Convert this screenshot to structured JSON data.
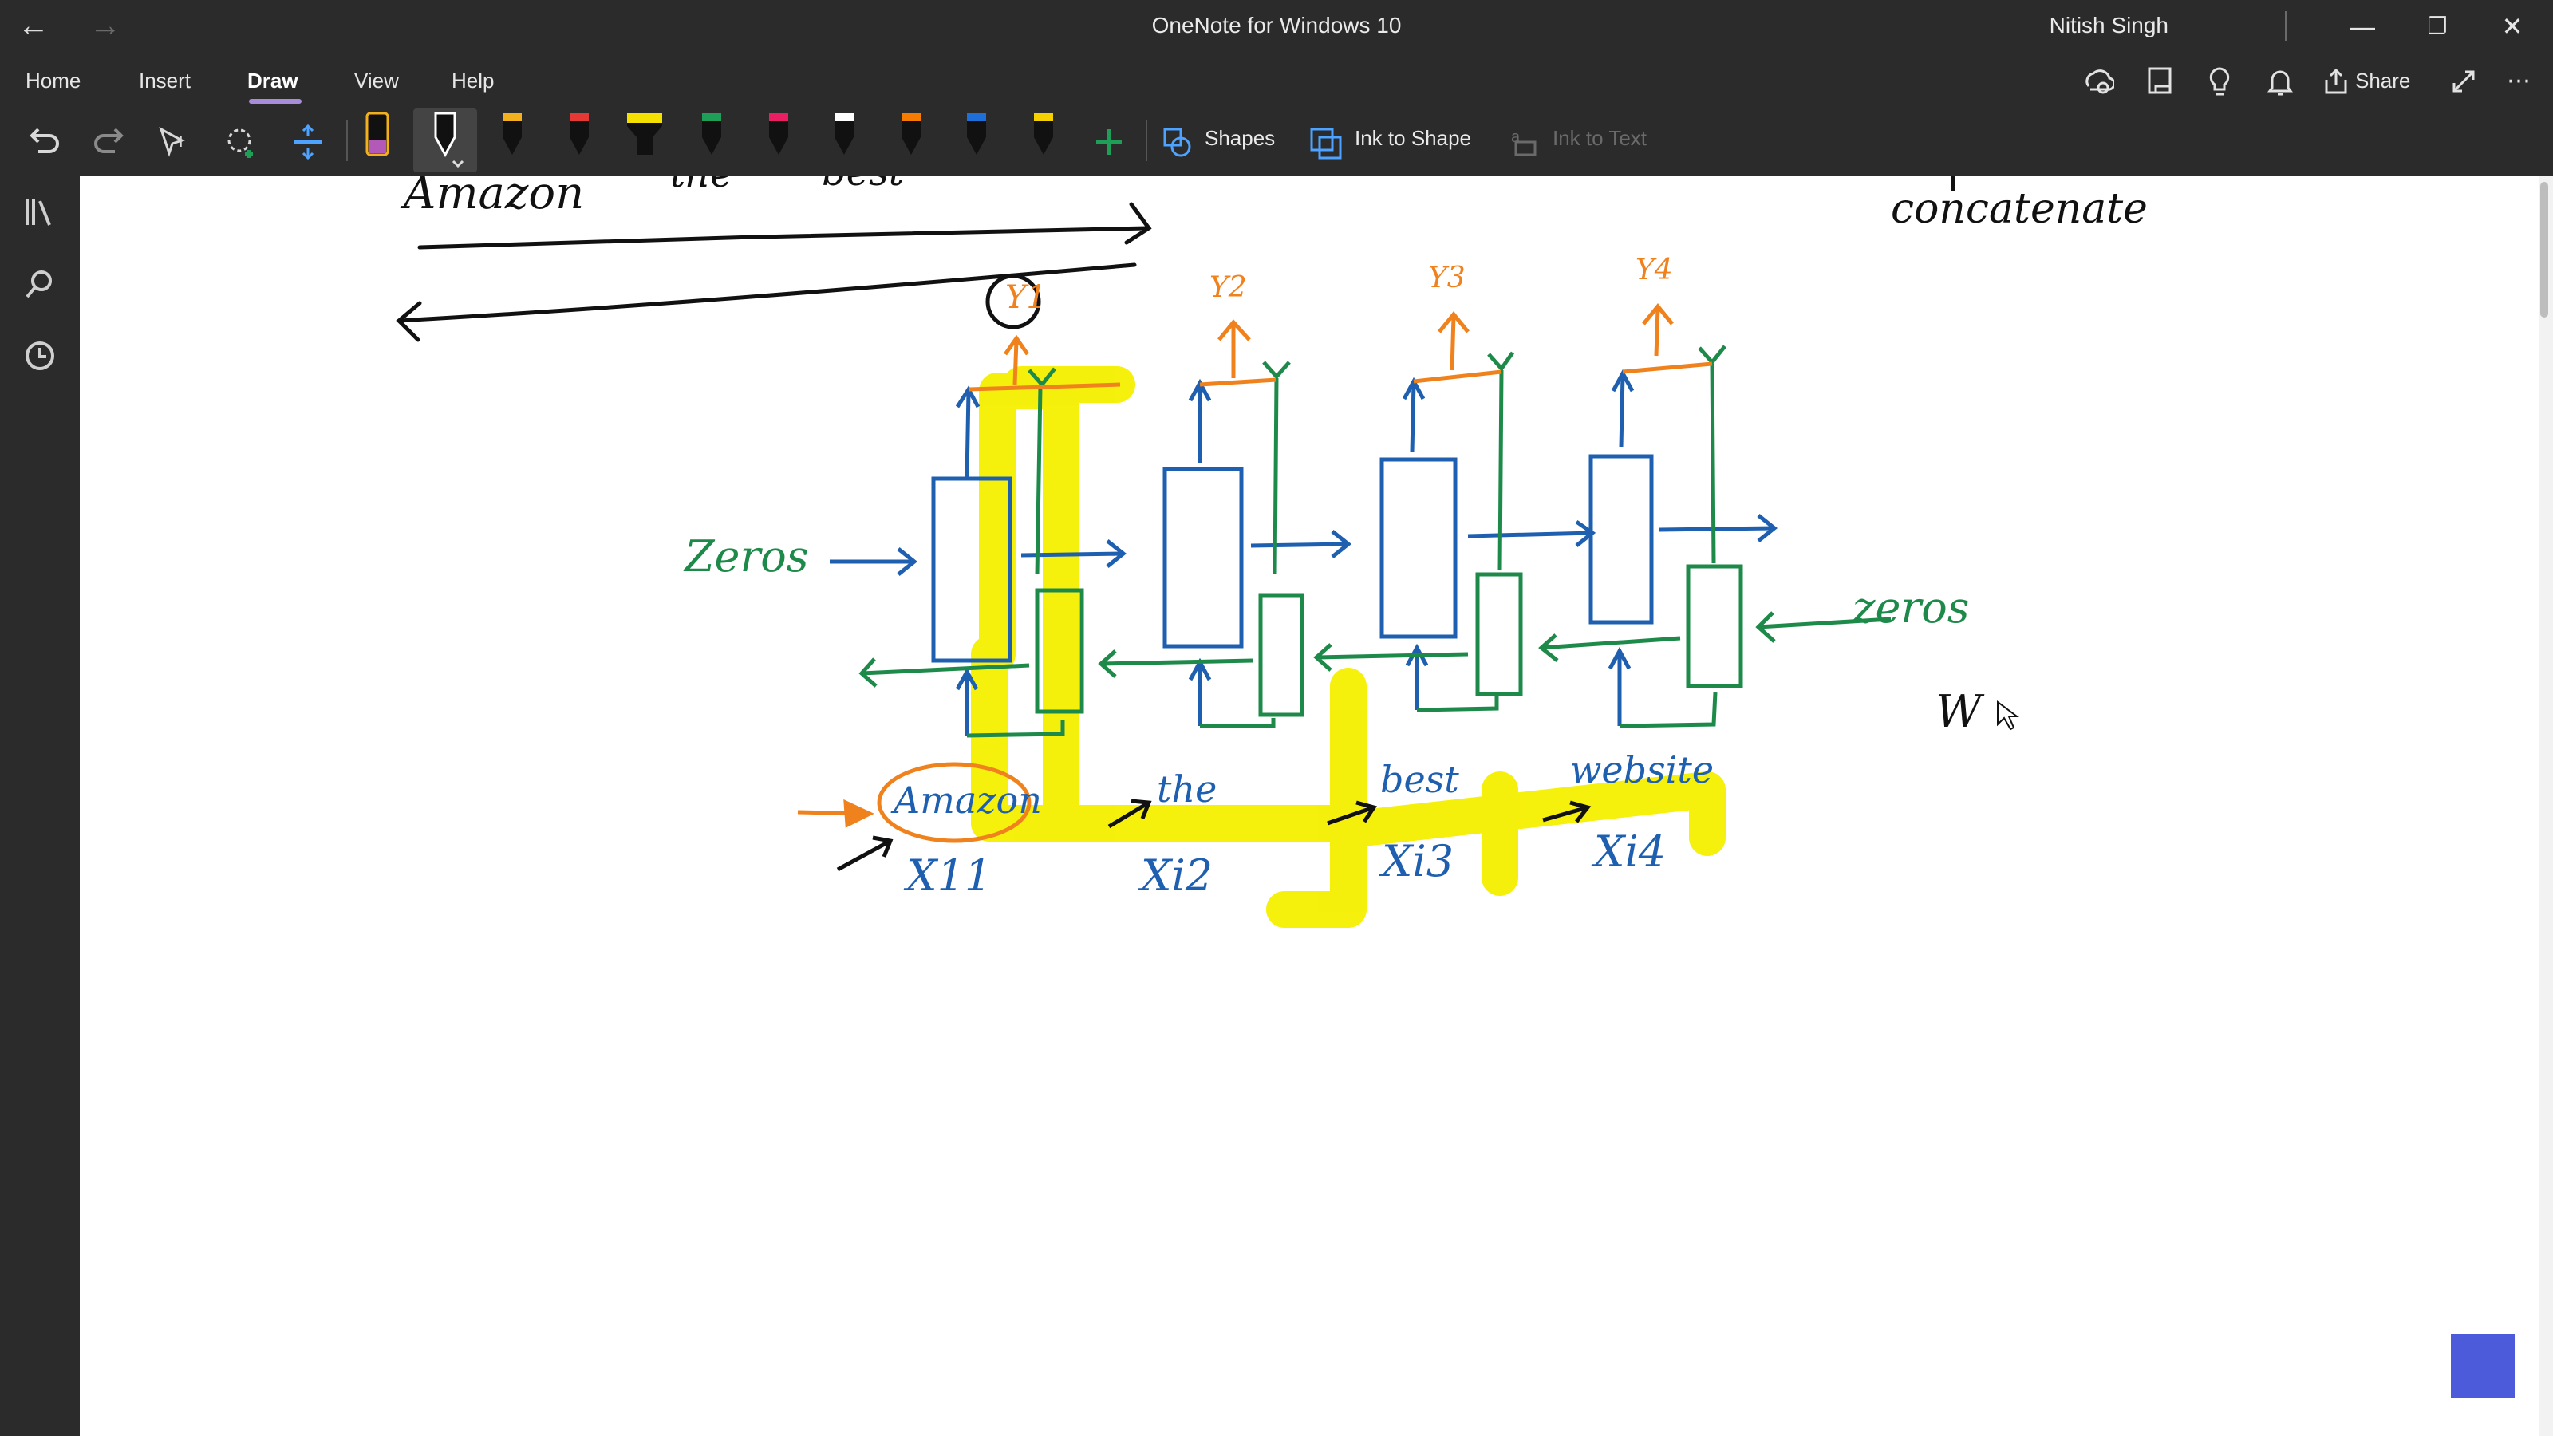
{
  "window": {
    "title": "OneNote for Windows 10",
    "user": "Nitish Singh",
    "back_icon": "back-arrow-icon",
    "forward_icon": "forward-arrow-icon",
    "minimize_label": "—",
    "restore_label": "❐",
    "close_label": "✕"
  },
  "menu": {
    "home": "Home",
    "insert": "Insert",
    "draw": "Draw",
    "view": "View",
    "help": "Help",
    "share": "Share"
  },
  "toolbar": {
    "shapes": "Shapes",
    "ink_to_shape": "Ink to Shape",
    "ink_to_text": "Ink to Text",
    "pen_colors": [
      "#111111",
      "#111111",
      "#f2b01e",
      "#e53935",
      "#f4e000",
      "#1e9e57",
      "#e91e63",
      "#ffffff",
      "#f57c00",
      "#1e6fd9",
      "#f4d000"
    ]
  },
  "ink": {
    "amazon_top": "Amazon",
    "the_top": "the",
    "best_top": "best",
    "concatenate": "concatenate",
    "zeros_left": "Zeros",
    "zeros_right": "zeros",
    "w_label": "W",
    "word1": "Amazon",
    "word2": "the",
    "word3": "best",
    "word4": "website",
    "x1": "X11",
    "x2": "Xi2",
    "x3": "Xi3",
    "x4": "Xi4",
    "y1": "Y1",
    "y2": "Y2",
    "y3": "Y3",
    "y4": "Y4"
  }
}
